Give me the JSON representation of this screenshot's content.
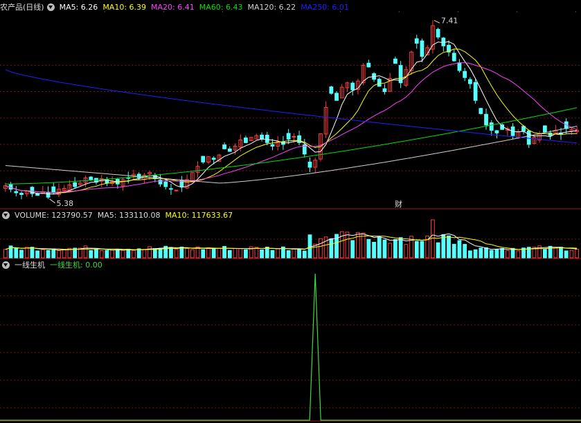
{
  "colors": {
    "up": "#ff3c3c",
    "down": "#54ffff",
    "ma5": "#ffffff",
    "ma10": "#ffff00",
    "ma20": "#ff40ff",
    "ma60": "#00e000",
    "ma120": "#d0d0d0",
    "ma250": "#2020ff",
    "grid": "#7a1414",
    "border": "#a01818",
    "signal": "#3cdc3c"
  },
  "main_panel": {
    "title": "农产品(日线)",
    "ma_labels": [
      {
        "text": "MA5: 6.26",
        "color": "#ffffff"
      },
      {
        "text": "MA10: 6.39",
        "color": "#ffff00"
      },
      {
        "text": "MA20: 6.41",
        "color": "#ff40ff"
      },
      {
        "text": "MA60: 6.43",
        "color": "#00e000"
      },
      {
        "text": "MA120: 6.22",
        "color": "#d0d0d0"
      },
      {
        "text": "MA250: 6.01",
        "color": "#2020ff"
      }
    ],
    "high_label": "7.41",
    "low_label": "5.38",
    "event_marker": "财"
  },
  "volume_panel": {
    "labels": [
      {
        "text": "VOLUME: 123790.57",
        "color": "#dddddd"
      },
      {
        "text": "MA5: 133110.08",
        "color": "#dddddd"
      },
      {
        "text": "MA10: 117633.67",
        "color": "#ffff00"
      }
    ]
  },
  "indicator_panel": {
    "title": "一线生机",
    "value_label": "一线生机: 0.00"
  },
  "chart_data": {
    "type": "candlestick",
    "title": "农产品(日线)",
    "price_range": [
      5.3,
      7.5
    ],
    "highest": 7.41,
    "lowest": 5.38,
    "ma": {
      "MA5": 6.26,
      "MA10": 6.39,
      "MA20": 6.41,
      "MA60": 6.43,
      "MA120": 6.22,
      "MA250": 6.01
    },
    "volume": {
      "VOLUME": 123790.57,
      "MA5": 133110.08,
      "MA10": 117633.67
    },
    "indicator": {
      "name": "一线生机",
      "value": 0.0,
      "spike_position": "single spike near candle 58 of 108"
    },
    "closes": [
      5.53,
      5.49,
      5.45,
      5.43,
      5.47,
      5.44,
      5.42,
      5.46,
      5.4,
      5.45,
      5.49,
      5.5,
      5.54,
      5.52,
      5.56,
      5.62,
      5.6,
      5.57,
      5.61,
      5.56,
      5.58,
      5.55,
      5.6,
      5.62,
      5.66,
      5.62,
      5.65,
      5.68,
      5.61,
      5.55,
      5.52,
      5.49,
      5.48,
      5.52,
      5.6,
      5.68,
      5.75,
      5.8,
      5.86,
      5.83,
      5.88,
      5.95,
      5.92,
      5.98,
      6.05,
      6.02,
      6.08,
      6.1,
      6.06,
      6.02,
      5.98,
      6.03,
      6.0,
      6.06,
      6.09,
      6.02,
      5.89,
      5.74,
      5.82,
      6.12,
      6.42,
      6.58,
      6.5,
      6.65,
      6.7,
      6.62,
      6.72,
      6.9,
      6.88,
      6.74,
      6.66,
      6.6,
      6.75,
      6.92,
      6.7,
      6.85,
      7.05,
      7.15,
      7.0,
      7.1,
      7.35,
      7.22,
      7.12,
      7.05,
      6.95,
      6.84,
      6.76,
      6.69,
      6.5,
      6.35,
      6.22,
      6.16,
      6.13,
      6.17,
      6.18,
      6.1,
      6.14,
      6.15,
      6.0,
      6.08,
      6.12,
      6.14,
      6.1,
      6.16,
      6.12,
      6.18,
      6.17,
      6.16
    ]
  }
}
